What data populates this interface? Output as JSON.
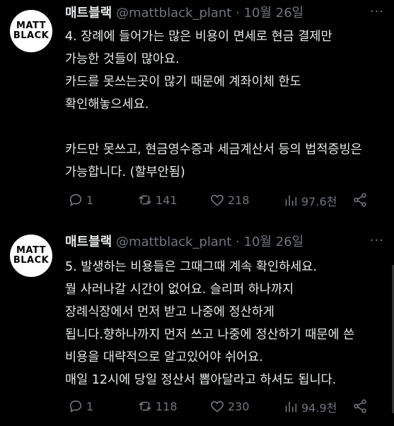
{
  "tweets": [
    {
      "avatar": {
        "line1": "MATT",
        "line2": "BLACK"
      },
      "name": "매트블랙",
      "handle": "@mattblack_plant",
      "dot": "·",
      "date": "10월 26일",
      "more": "···",
      "lines": [
        "4. 장례에 들어가는 많은 비용이 면세로 현금 결제만",
        "가능한 것들이 많아요.",
        "카드를 못쓰는곳이 많기 때문에 계좌이체 한도",
        "확인해놓으세요.",
        "",
        "카드만 못쓰고, 현금영수증과 세금계산서 등의 법적증빙은",
        "가능합니다. (할부안됨)"
      ],
      "replies": "1",
      "retweets": "141",
      "likes": "218",
      "views": "97.6천"
    },
    {
      "avatar": {
        "line1": "MATT",
        "line2": "BLACK"
      },
      "name": "매트블랙",
      "handle": "@mattblack_plant",
      "dot": "·",
      "date": "10월 26일",
      "more": "···",
      "lines": [
        "5. 발생하는 비용들은 그때그때 계속 확인하세요.",
        "뭘 사러나갈 시간이 없어요. 슬리퍼 하나까지",
        "장례식장에서 먼저 받고 나중에 정산하게",
        "됩니다.향하나까지 먼저 쓰고 나중에 정산하기 때문에 쓴",
        "비용을 대략적으로 알고있어야 쉬어요.",
        "매일 12시에 당일 정산서 뽑아달라고 하셔도 됩니다."
      ],
      "replies": "1",
      "retweets": "118",
      "likes": "230",
      "views": "94.9천"
    }
  ]
}
